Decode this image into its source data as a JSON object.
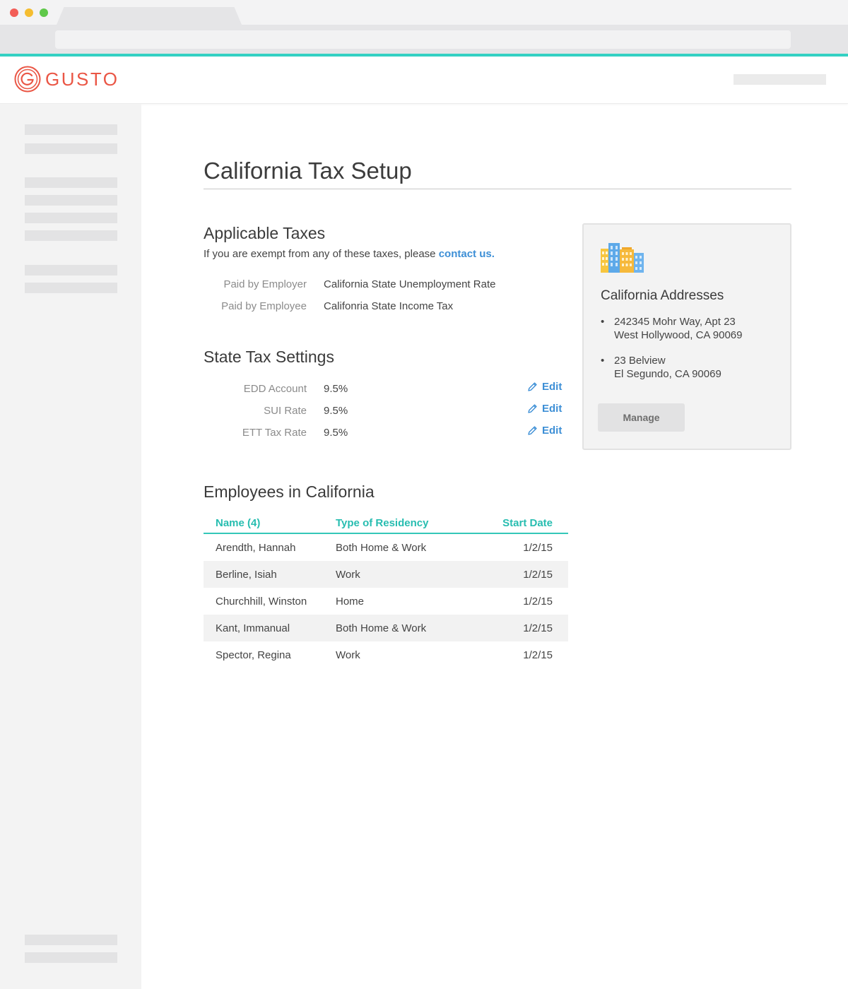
{
  "brand": {
    "name": "GUSTO",
    "accent_color": "#34d1c3",
    "logo_color": "#ea5645",
    "link_color": "#3d8fd6"
  },
  "page": {
    "title": "California Tax Setup"
  },
  "applicable_taxes": {
    "title": "Applicable Taxes",
    "subtext": "If you are exempt from any of these taxes, please",
    "link_text": "contact us.",
    "rows": [
      {
        "label": "Paid by Employer",
        "value": "California State Unemployment Rate"
      },
      {
        "label": "Paid by Employee",
        "value": "Califonria State Income Tax"
      }
    ]
  },
  "state_tax_settings": {
    "title": "State Tax Settings",
    "edit_label": "Edit",
    "edit_icon": "pencil-icon",
    "rows": [
      {
        "label": "EDD Account",
        "value": "9.5%"
      },
      {
        "label": "SUI Rate",
        "value": "9.5%"
      },
      {
        "label": "ETT Tax Rate",
        "value": "9.5%"
      }
    ]
  },
  "employees": {
    "title": "Employees in California",
    "columns": [
      "Name (4)",
      "Type of Residency",
      "Start Date"
    ],
    "header_color": "#27bdb0",
    "rows": [
      {
        "name": "Arendth, Hannah",
        "residency": "Both Home & Work",
        "start": "1/2/15"
      },
      {
        "name": "Berline, Isiah",
        "residency": "Work",
        "start": "1/2/15"
      },
      {
        "name": "Churchhill, Winston",
        "residency": "Home",
        "start": "1/2/15"
      },
      {
        "name": "Kant, Immanual",
        "residency": "Both Home & Work",
        "start": "1/2/15"
      },
      {
        "name": "Spector, Regina",
        "residency": "Work",
        "start": "1/2/15"
      }
    ]
  },
  "addresses_card": {
    "icon": "buildings-icon",
    "title": "California Addresses",
    "addresses": [
      {
        "line1": "242345 Mohr Way, Apt 23",
        "line2": "West Hollywood, CA 90069"
      },
      {
        "line1": "23 Belview",
        "line2": "El Segundo, CA 90069"
      }
    ],
    "button_label": "Manage"
  }
}
